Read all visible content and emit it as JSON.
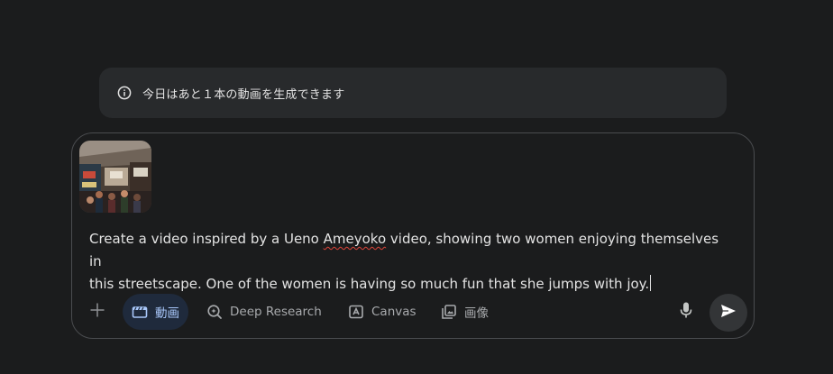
{
  "notice": {
    "icon": "info-icon",
    "text": "今日はあと１本の動画を生成できます"
  },
  "prompt": {
    "attachment": {
      "icon": "image-thumbnail"
    },
    "text_before": "Create a video inspired by a Ueno ",
    "misspelled_word": "Ameyoko",
    "text_after": " video, showing two women enjoying themselves in\nthis streetscape. One of the women is having so much fun that she jumps with joy."
  },
  "toolbar": {
    "plus_icon": "plus-icon",
    "tools": [
      {
        "label": "動画",
        "icon": "video-clapper-icon",
        "active": true
      },
      {
        "label": "Deep Research",
        "icon": "deep-research-icon",
        "active": false
      },
      {
        "label": "Canvas",
        "icon": "canvas-icon",
        "active": false
      },
      {
        "label": "画像",
        "icon": "image-gallery-icon",
        "active": false
      }
    ],
    "mic_icon": "microphone-icon",
    "send_icon": "send-icon"
  },
  "colors": {
    "background": "#1b1c1d",
    "banner": "#282a2c",
    "active_chip_bg": "#1f2a3c",
    "active_chip_text": "#a8c7fa",
    "inactive_text": "#a8aaad",
    "spellcheck": "#e0453a"
  }
}
